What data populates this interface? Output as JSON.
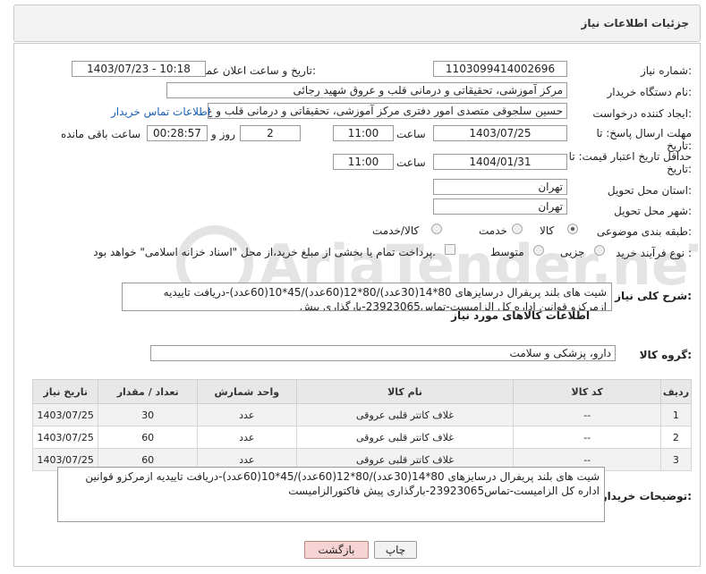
{
  "header": {
    "title": "جزئیات اطلاعات نیاز"
  },
  "fields": {
    "need_number_label": "شماره نیاز:",
    "need_number": "1103099414002696",
    "announce_label": "تاریخ و ساعت اعلان عمومی:",
    "announce_value": "1403/07/23 - 10:18",
    "buyer_org_label": "نام دستگاه خریدار:",
    "buyer_org": "مرکز آموزشی، تحقیقاتی و درمانی قلب و عروق شهید رجائی",
    "requester_label": "ایجاد کننده درخواست:",
    "requester": "حسین سلجوقی متصدی امور دفتری مرکز آموزشی، تحقیقاتی و درمانی قلب و ع",
    "buyer_contact_link": "اطلاعات تماس خریدار",
    "deadline_label": "مهلت ارسال پاسخ: تا",
    "deadline_label2": "تاریخ:",
    "deadline_date": "1403/07/25",
    "time_label": "ساعت",
    "deadline_time": "11:00",
    "days_value": "2",
    "days_label": "روز و",
    "remaining_time": "00:28:57",
    "remaining_label": "ساعت باقی مانده",
    "validity_label": "حداقل تاریخ اعتبار قیمت: تا",
    "validity_label2": "تاریخ:",
    "validity_date": "1404/01/31",
    "validity_time_label": "ساعت",
    "validity_time": "11:00",
    "province_label": "استان محل تحویل:",
    "province": "تهران",
    "city_label": "شهر محل تحویل:",
    "city": "تهران",
    "category_label": "طبقه بندی موضوعی:",
    "category_options": [
      "کالا",
      "خدمت",
      "کالا/خدمت"
    ],
    "category_selected": "کالا",
    "process_label": "نوع فرآیند خرید :",
    "process_options": [
      "جزیی",
      "متوسط"
    ],
    "payment_note": "پرداخت تمام یا بخشی از مبلغ خرید،از محل \"اسناد خزانه اسلامی\" خواهد بود."
  },
  "summary": {
    "label": "شرح کلی نیاز:",
    "text": "شیت های بلند پریفرال درسایزهای 80*14(30عدد)/80*12(60عدد)/45*10(60عدد)-دریافت تاییدیه ازمرکزو قوانین اداره کل الزامیست-تماس23923065-بارگذاری پیش"
  },
  "goods": {
    "section_title": "اطلاعات کالاهای مورد نیاز",
    "group_label": "گروه کالا:",
    "group_value": "دارو، پزشکی و سلامت",
    "columns": [
      "ردیف",
      "کد کالا",
      "نام کالا",
      "واحد شمارش",
      "تعداد / مقدار",
      "تاریخ نیاز"
    ],
    "rows": [
      [
        "1",
        "--",
        "غلاف کاتتر قلبی عروقی",
        "عدد",
        "30",
        "1403/07/25"
      ],
      [
        "2",
        "--",
        "غلاف کاتتر قلبی عروقی",
        "عدد",
        "60",
        "1403/07/25"
      ],
      [
        "3",
        "--",
        "غلاف کاتتر قلبی عروقی",
        "عدد",
        "60",
        "1403/07/25"
      ]
    ]
  },
  "buyer_notes": {
    "label": "توضیحات خریدار:",
    "text": "شیت های بلند پریفرال درسایزهای 80*14(30عدد)/80*12(60عدد)/45*10(60عدد)-دریافت تاییدیه ازمرکزو قوانین اداره کل الزامیست-تماس23923065-بارگذاری پیش فاکتورالزامیست"
  },
  "buttons": {
    "print": "چاپ",
    "back": "بازگشت"
  },
  "colors": {
    "header_bg": "#f3f3f3",
    "link": "#1a5fb4",
    "back_button_bg": "#f7d4d4",
    "table_header_bg": "#e8e8e8"
  },
  "watermark": "AriaTender.neT"
}
